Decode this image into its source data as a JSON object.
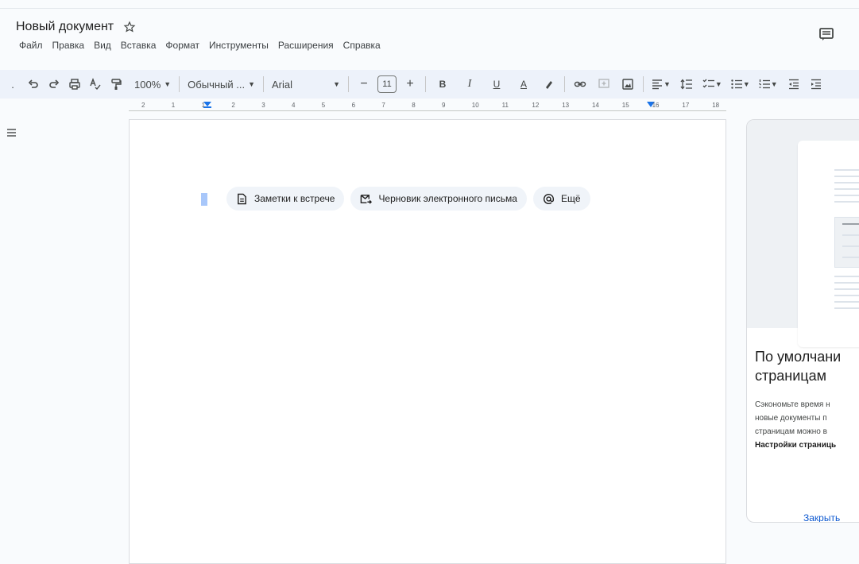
{
  "document": {
    "title": "Новый документ"
  },
  "menu": [
    "Файл",
    "Правка",
    "Вид",
    "Вставка",
    "Формат",
    "Инструменты",
    "Расширения",
    "Справка"
  ],
  "toolbar": {
    "zoom": "100%",
    "style": "Обычный ...",
    "font": "Arial",
    "font_size": "11",
    "minus": "−",
    "plus": "+",
    "bold": "B",
    "italic": "I",
    "underline": "U",
    "text_color": "A"
  },
  "ruler": {
    "ticks": [
      "2",
      "1",
      "1",
      "2",
      "3",
      "4",
      "5",
      "6",
      "7",
      "8",
      "9",
      "10",
      "11",
      "12",
      "13",
      "14",
      "15",
      "16",
      "17",
      "18"
    ]
  },
  "chips": [
    {
      "label": "Заметки к встрече",
      "icon": "document-icon"
    },
    {
      "label": "Черновик электронного письма",
      "icon": "email-draft-icon"
    },
    {
      "label": "Ещё",
      "icon": "at-icon"
    }
  ],
  "side_panel": {
    "title_line1": "По умолчани",
    "title_line2": "страницам",
    "body_line1": "Сэкономьте время н",
    "body_line2": "новые документы п",
    "body_line3": "страницам можно в",
    "body_bold": "Настройки страниць",
    "close": "Закрыть"
  },
  "colors": {
    "accent": "#0b57d0",
    "toolbar_bg": "#edf2fa",
    "chip_bg": "#f0f4f9",
    "selection": "#a8c7fa"
  }
}
